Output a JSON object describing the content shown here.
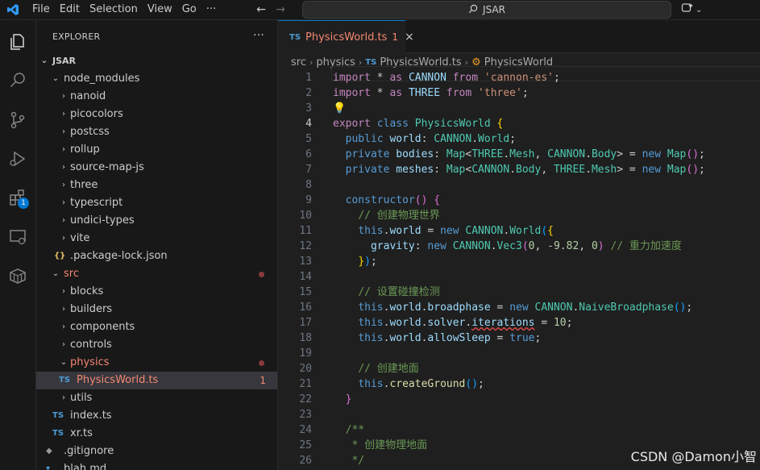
{
  "menu": [
    "File",
    "Edit",
    "Selection",
    "View",
    "Go",
    "···"
  ],
  "search_label": "JSAR",
  "explorer": {
    "title": "EXPLORER",
    "more": "···",
    "root": "JSAR",
    "items": [
      {
        "label": "node_modules",
        "depth": 1,
        "chev": "⌄",
        "kind": "folder"
      },
      {
        "label": "nanoid",
        "depth": 2,
        "chev": "›",
        "kind": "folder"
      },
      {
        "label": "picocolors",
        "depth": 2,
        "chev": "›",
        "kind": "folder"
      },
      {
        "label": "postcss",
        "depth": 2,
        "chev": "›",
        "kind": "folder"
      },
      {
        "label": "rollup",
        "depth": 2,
        "chev": "›",
        "kind": "folder"
      },
      {
        "label": "source-map-js",
        "depth": 2,
        "chev": "›",
        "kind": "folder"
      },
      {
        "label": "three",
        "depth": 2,
        "chev": "›",
        "kind": "folder"
      },
      {
        "label": "typescript",
        "depth": 2,
        "chev": "›",
        "kind": "folder"
      },
      {
        "label": "undici-types",
        "depth": 2,
        "chev": "›",
        "kind": "folder"
      },
      {
        "label": "vite",
        "depth": 2,
        "chev": "›",
        "kind": "folder"
      },
      {
        "label": ".package-lock.json",
        "depth": 2,
        "kind": "json",
        "icon": "{}"
      },
      {
        "label": "src",
        "depth": 1,
        "chev": "⌄",
        "kind": "folder",
        "error": true
      },
      {
        "label": "blocks",
        "depth": 2,
        "chev": "›",
        "kind": "folder"
      },
      {
        "label": "builders",
        "depth": 2,
        "chev": "›",
        "kind": "folder"
      },
      {
        "label": "components",
        "depth": 2,
        "chev": "›",
        "kind": "folder"
      },
      {
        "label": "controls",
        "depth": 2,
        "chev": "›",
        "kind": "folder"
      },
      {
        "label": "physics",
        "depth": 2,
        "chev": "⌄",
        "kind": "folder",
        "error": true
      },
      {
        "label": "PhysicsWorld.ts",
        "depth": 3,
        "kind": "ts",
        "icon": "TS",
        "error": true,
        "count": "1",
        "selected": true
      },
      {
        "label": "utils",
        "depth": 2,
        "chev": "›",
        "kind": "folder"
      },
      {
        "label": "index.ts",
        "depth": 2,
        "kind": "ts",
        "icon": "TS"
      },
      {
        "label": "xr.ts",
        "depth": 2,
        "kind": "ts",
        "icon": "TS"
      },
      {
        "label": ".gitignore",
        "depth": 1,
        "kind": "git",
        "icon": "◆"
      },
      {
        "label": "blah.md",
        "depth": 1,
        "kind": "md",
        "icon": "▾"
      }
    ]
  },
  "tab": {
    "icon": "TS",
    "name": "PhysicsWorld.ts",
    "count": "1",
    "close": "×"
  },
  "breadcrumb": [
    "src",
    "physics",
    "PhysicsWorld.ts",
    "PhysicsWorld"
  ],
  "activity_badge": "1",
  "watermark": "CSDN @Damon小智",
  "code_lines": [
    {
      "n": "1",
      "tokens": [
        [
          "kw2",
          "import"
        ],
        [
          "",
          " "
        ],
        [
          "",
          "* "
        ],
        [
          "kw2",
          "as"
        ],
        [
          "",
          " "
        ],
        [
          "var",
          "CANNON"
        ],
        [
          "",
          " "
        ],
        [
          "kw2",
          "from"
        ],
        [
          "",
          " "
        ],
        [
          "str",
          "'cannon-es'"
        ],
        [
          "",
          ";"
        ]
      ]
    },
    {
      "n": "2",
      "tokens": [
        [
          "kw2",
          "import"
        ],
        [
          "",
          " "
        ],
        [
          "",
          "* "
        ],
        [
          "kw2",
          "as"
        ],
        [
          "",
          " "
        ],
        [
          "var",
          "THREE"
        ],
        [
          "",
          " "
        ],
        [
          "kw2",
          "from"
        ],
        [
          "",
          " "
        ],
        [
          "str",
          "'three'"
        ],
        [
          "",
          ";"
        ]
      ]
    },
    {
      "n": "3",
      "tokens": [
        [
          "bulb",
          "💡"
        ]
      ]
    },
    {
      "n": "4",
      "current": true,
      "tokens": [
        [
          "kw2",
          "export"
        ],
        [
          "",
          " "
        ],
        [
          "kw",
          "class"
        ],
        [
          "",
          " "
        ],
        [
          "cls",
          "PhysicsWorld"
        ],
        [
          "",
          " "
        ],
        [
          "br1",
          "{"
        ]
      ]
    },
    {
      "n": "5",
      "tokens": [
        [
          "",
          "  "
        ],
        [
          "kw",
          "public"
        ],
        [
          "",
          " "
        ],
        [
          "var",
          "world"
        ],
        [
          "",
          ": "
        ],
        [
          "cls",
          "CANNON"
        ],
        [
          "",
          "."
        ],
        [
          "cls",
          "World"
        ],
        [
          "",
          ";"
        ]
      ]
    },
    {
      "n": "6",
      "tokens": [
        [
          "",
          "  "
        ],
        [
          "kw",
          "private"
        ],
        [
          "",
          " "
        ],
        [
          "var",
          "bodies"
        ],
        [
          "",
          ": "
        ],
        [
          "cls",
          "Map"
        ],
        [
          "",
          "<"
        ],
        [
          "cls",
          "THREE"
        ],
        [
          "",
          "."
        ],
        [
          "cls",
          "Mesh"
        ],
        [
          "",
          ", "
        ],
        [
          "cls",
          "CANNON"
        ],
        [
          "",
          "."
        ],
        [
          "cls",
          "Body"
        ],
        [
          "",
          "> = "
        ],
        [
          "kw",
          "new"
        ],
        [
          "",
          " "
        ],
        [
          "cls",
          "Map"
        ],
        [
          "br2",
          "()"
        ],
        [
          "",
          ";"
        ]
      ]
    },
    {
      "n": "7",
      "tokens": [
        [
          "",
          "  "
        ],
        [
          "kw",
          "private"
        ],
        [
          "",
          " "
        ],
        [
          "var",
          "meshes"
        ],
        [
          "",
          ": "
        ],
        [
          "cls",
          "Map"
        ],
        [
          "",
          "<"
        ],
        [
          "cls",
          "CANNON"
        ],
        [
          "",
          "."
        ],
        [
          "cls",
          "Body"
        ],
        [
          "",
          ", "
        ],
        [
          "cls",
          "THREE"
        ],
        [
          "",
          "."
        ],
        [
          "cls",
          "Mesh"
        ],
        [
          "",
          "> = "
        ],
        [
          "kw",
          "new"
        ],
        [
          "",
          " "
        ],
        [
          "cls",
          "Map"
        ],
        [
          "br2",
          "()"
        ],
        [
          "",
          ";"
        ]
      ]
    },
    {
      "n": "8",
      "tokens": []
    },
    {
      "n": "9",
      "tokens": [
        [
          "",
          "  "
        ],
        [
          "kw",
          "constructor"
        ],
        [
          "br2",
          "()"
        ],
        [
          "",
          " "
        ],
        [
          "br2",
          "{"
        ]
      ]
    },
    {
      "n": "10",
      "tokens": [
        [
          "",
          "    "
        ],
        [
          "cmt",
          "// 创建物理世界"
        ]
      ]
    },
    {
      "n": "11",
      "tokens": [
        [
          "",
          "    "
        ],
        [
          "kw",
          "this"
        ],
        [
          "",
          "."
        ],
        [
          "var",
          "world"
        ],
        [
          "",
          " = "
        ],
        [
          "kw",
          "new"
        ],
        [
          "",
          " "
        ],
        [
          "cls",
          "CANNON"
        ],
        [
          "",
          "."
        ],
        [
          "cls",
          "World"
        ],
        [
          "br3",
          "("
        ],
        [
          "br1",
          "{"
        ]
      ]
    },
    {
      "n": "12",
      "tokens": [
        [
          "",
          "      "
        ],
        [
          "var",
          "gravity"
        ],
        [
          "",
          ": "
        ],
        [
          "kw",
          "new"
        ],
        [
          "",
          " "
        ],
        [
          "cls",
          "CANNON"
        ],
        [
          "",
          "."
        ],
        [
          "cls",
          "Vec3"
        ],
        [
          "br2",
          "("
        ],
        [
          "num",
          "0"
        ],
        [
          "",
          ", "
        ],
        [
          "num",
          "-9.82"
        ],
        [
          "",
          ", "
        ],
        [
          "num",
          "0"
        ],
        [
          "br2",
          ")"
        ],
        [
          "",
          " "
        ],
        [
          "cmt",
          "// 重力加速度"
        ]
      ]
    },
    {
      "n": "13",
      "tokens": [
        [
          "",
          "    "
        ],
        [
          "br1",
          "}"
        ],
        [
          "br3",
          ")"
        ],
        [
          "",
          ";"
        ]
      ]
    },
    {
      "n": "14",
      "tokens": []
    },
    {
      "n": "15",
      "tokens": [
        [
          "",
          "    "
        ],
        [
          "cmt",
          "// 设置碰撞检测"
        ]
      ]
    },
    {
      "n": "16",
      "tokens": [
        [
          "",
          "    "
        ],
        [
          "kw",
          "this"
        ],
        [
          "",
          "."
        ],
        [
          "var",
          "world"
        ],
        [
          "",
          "."
        ],
        [
          "var",
          "broadphase"
        ],
        [
          "",
          " = "
        ],
        [
          "kw",
          "new"
        ],
        [
          "",
          " "
        ],
        [
          "cls",
          "CANNON"
        ],
        [
          "",
          "."
        ],
        [
          "cls",
          "NaiveBroadphase"
        ],
        [
          "br3",
          "()"
        ],
        [
          "",
          ";"
        ]
      ]
    },
    {
      "n": "17",
      "tokens": [
        [
          "",
          "    "
        ],
        [
          "kw",
          "this"
        ],
        [
          "",
          "."
        ],
        [
          "var",
          "world"
        ],
        [
          "",
          "."
        ],
        [
          "var",
          "solver"
        ],
        [
          "",
          "."
        ],
        [
          "var squig",
          "iterations"
        ],
        [
          "",
          " = "
        ],
        [
          "num",
          "10"
        ],
        [
          "",
          ";"
        ]
      ]
    },
    {
      "n": "18",
      "tokens": [
        [
          "",
          "    "
        ],
        [
          "kw",
          "this"
        ],
        [
          "",
          "."
        ],
        [
          "var",
          "world"
        ],
        [
          "",
          "."
        ],
        [
          "var",
          "allowSleep"
        ],
        [
          "",
          " = "
        ],
        [
          "kw",
          "true"
        ],
        [
          "",
          ";"
        ]
      ]
    },
    {
      "n": "19",
      "tokens": []
    },
    {
      "n": "20",
      "tokens": [
        [
          "",
          "    "
        ],
        [
          "cmt",
          "// 创建地面"
        ]
      ]
    },
    {
      "n": "21",
      "tokens": [
        [
          "",
          "    "
        ],
        [
          "kw",
          "this"
        ],
        [
          "",
          "."
        ],
        [
          "fn",
          "createGround"
        ],
        [
          "br3",
          "()"
        ],
        [
          "",
          ";"
        ]
      ]
    },
    {
      "n": "22",
      "tokens": [
        [
          "",
          "  "
        ],
        [
          "br2",
          "}"
        ]
      ]
    },
    {
      "n": "23",
      "tokens": []
    },
    {
      "n": "24",
      "tokens": [
        [
          "",
          "  "
        ],
        [
          "cmt",
          "/**"
        ]
      ]
    },
    {
      "n": "25",
      "tokens": [
        [
          "",
          "   "
        ],
        [
          "cmt",
          "* 创建物理地面"
        ]
      ]
    },
    {
      "n": "26",
      "tokens": [
        [
          "",
          "   "
        ],
        [
          "cmt",
          "*/"
        ]
      ]
    }
  ]
}
